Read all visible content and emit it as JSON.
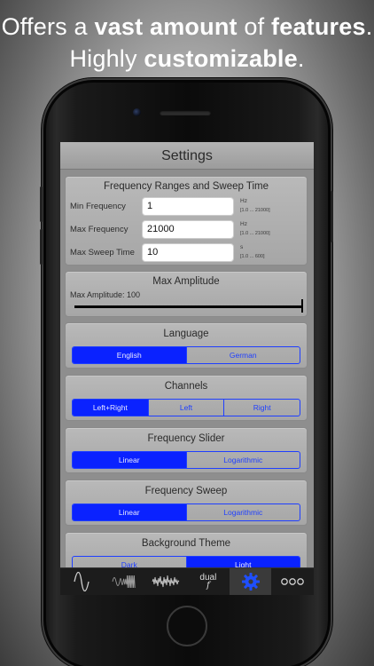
{
  "headline": {
    "line1_prefix": "Offers a",
    "line1_bold1": "vast amount",
    "line1_mid": "of",
    "line1_bold2": "features",
    "line1_suffix": ".",
    "line2_prefix": "Highly",
    "line2_bold": "customizable",
    "line2_suffix": "."
  },
  "screen": {
    "title": "Settings",
    "freq_section": {
      "title": "Frequency Ranges and Sweep Time",
      "fields": [
        {
          "label": "Min Frequency",
          "value": "1",
          "unit": "Hz",
          "range": "[1.0 ... 21000]"
        },
        {
          "label": "Max Frequency",
          "value": "21000",
          "unit": "Hz",
          "range": "[1.0 ... 21000]"
        },
        {
          "label": "Max Sweep Time",
          "value": "10",
          "unit": "s",
          "range": "[1.0 ... 600]"
        }
      ]
    },
    "amplitude_section": {
      "title": "Max Amplitude",
      "label": "Max Amplitude: 100",
      "level": 1.0
    },
    "language_section": {
      "title": "Language",
      "options": [
        "English",
        "German"
      ],
      "selected": "English"
    },
    "channels_section": {
      "title": "Channels",
      "options": [
        "Left+Right",
        "Left",
        "Right"
      ],
      "selected": "Left+Right"
    },
    "slider_section": {
      "title": "Frequency Slider",
      "options": [
        "Linear",
        "Logarithmic"
      ],
      "selected": "Linear"
    },
    "sweep_section": {
      "title": "Frequency Sweep",
      "options": [
        "Linear",
        "Logarithmic"
      ],
      "selected": "Linear"
    },
    "theme_section": {
      "title": "Background Theme",
      "options": [
        "Dark",
        "Light"
      ],
      "selected": "Light"
    },
    "tabbar": {
      "tabs": [
        "sine-wave-icon",
        "sweep-icon",
        "noise-icon",
        "dual-frequency-icon",
        "gear-icon",
        "more-icon"
      ],
      "dual_label": "dual",
      "dual_symbol": "f",
      "active": "gear-icon"
    }
  },
  "colors": {
    "accent": "#0a22ff",
    "card": "#b0b0b0",
    "tab_icon": "#cfcfcf",
    "active_icon": "#1f4fff"
  }
}
